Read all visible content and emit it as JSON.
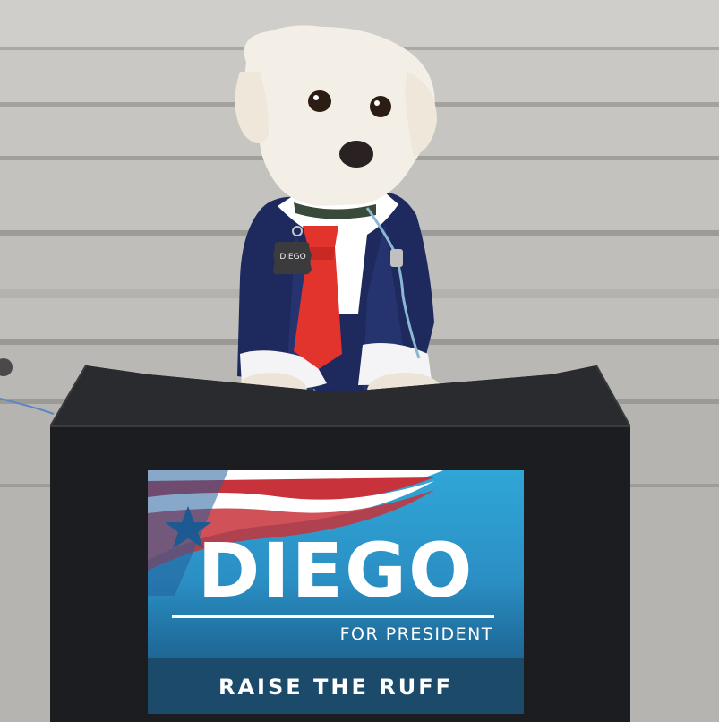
{
  "photo": {
    "palette": {
      "steps": "#c4c3bf",
      "step_edge": "#9e9d99",
      "fur": "#f3efe6",
      "suit": "#1e2a5e",
      "tie": "#e2332c",
      "shirt": "#ffffff",
      "podium": "#1c1d20",
      "sign_blue": "#2b8fc4",
      "sign_dark": "#1c4a6a",
      "flag_red": "#c8323a"
    }
  },
  "sign": {
    "name": "DIEGO",
    "subtitle": "FOR PRESIDENT",
    "slogan": "RAISE THE RUFF"
  },
  "dog_tag": {
    "text": "DIEGO"
  }
}
